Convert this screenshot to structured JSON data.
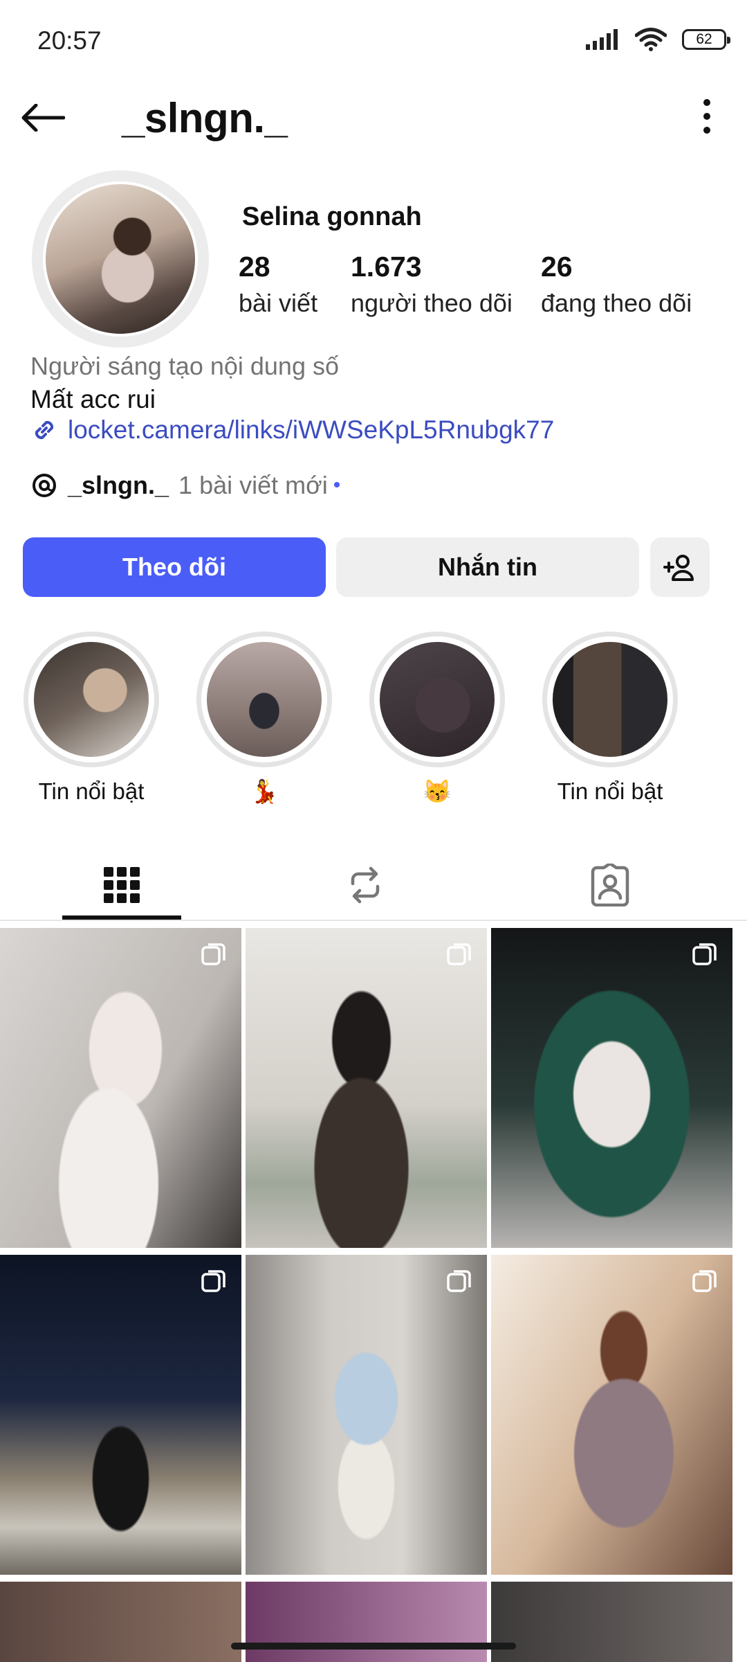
{
  "status_bar": {
    "time": "20:57",
    "battery": "62"
  },
  "header": {
    "username": "_slngn._"
  },
  "profile": {
    "display_name": "Selina gonnah",
    "stats": [
      {
        "count": "28",
        "label": "bài viết"
      },
      {
        "count": "1.673",
        "label": "người theo dõi"
      },
      {
        "count": "26",
        "label": "đang theo dõi"
      }
    ],
    "category": "Người sáng tạo nội dung số",
    "bio": "Mất acc rui",
    "link": "locket.camera/links/iWWSeKpL5Rnubgk77",
    "threads": {
      "handle": "_slngn._",
      "new_posts": "1 bài viết mới",
      "dot": "•"
    }
  },
  "actions": {
    "follow": "Theo dõi",
    "message": "Nhắn tin"
  },
  "highlights": [
    {
      "label": "Tin nổi bật"
    },
    {
      "label": "💃"
    },
    {
      "label": "😽"
    },
    {
      "label": "Tin nổi bật"
    }
  ],
  "tabs": [
    "posts-grid-icon",
    "reels-repost-icon",
    "tagged-icon"
  ],
  "colors": {
    "accent": "#4a5df7",
    "link": "#3b4cc0",
    "secondary_text": "#737373",
    "button_gray": "#efefef"
  }
}
